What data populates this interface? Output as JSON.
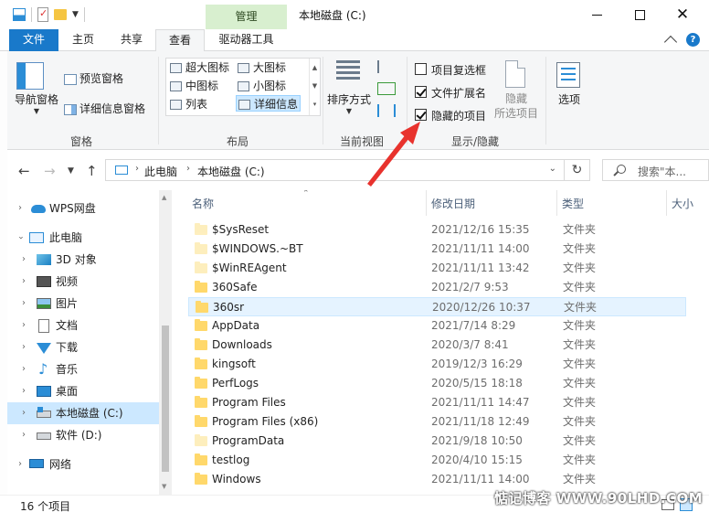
{
  "window": {
    "title": "本地磁盘 (C:)",
    "context_tab_group": "管理"
  },
  "tabs": [
    {
      "label": "文件"
    },
    {
      "label": "主页"
    },
    {
      "label": "共享"
    },
    {
      "label": "查看"
    },
    {
      "label": "驱动器工具"
    }
  ],
  "ribbon": {
    "panes": {
      "nav_pane": "导航窗格",
      "preview_pane": "预览窗格",
      "details_pane": "详细信息窗格",
      "group_label": "窗格"
    },
    "layout": {
      "items": [
        "超大图标",
        "大图标",
        "中图标",
        "小图标",
        "列表",
        "详细信息"
      ],
      "selected": "详细信息",
      "group_label": "布局"
    },
    "current_view": {
      "sort_by": "排序方式",
      "group_label": "当前视图"
    },
    "show_hide": {
      "item_checkboxes": {
        "label": "项目复选框",
        "checked": false
      },
      "file_extensions": {
        "label": "文件扩展名",
        "checked": true
      },
      "hidden_items": {
        "label": "隐藏的项目",
        "checked": true
      },
      "hide_selected": "隐藏",
      "hide_selected_2": "所选项目",
      "group_label": "显示/隐藏"
    },
    "options": "选项"
  },
  "address": {
    "crumbs": [
      "此电脑",
      "本地磁盘 (C:)"
    ],
    "search_placeholder": "搜索\"本..."
  },
  "nav_pane": {
    "items": [
      {
        "label": "WPS网盘",
        "icon": "cloud-icon"
      },
      {
        "label": "此电脑",
        "icon": "pc-icon"
      },
      {
        "label": "3D 对象",
        "icon": "3d-objects-icon"
      },
      {
        "label": "视频",
        "icon": "video-icon"
      },
      {
        "label": "图片",
        "icon": "pictures-icon"
      },
      {
        "label": "文档",
        "icon": "documents-icon"
      },
      {
        "label": "下载",
        "icon": "download-icon"
      },
      {
        "label": "音乐",
        "icon": "music-icon"
      },
      {
        "label": "桌面",
        "icon": "desktop-icon"
      },
      {
        "label": "本地磁盘 (C:)",
        "icon": "drive-c-icon",
        "selected": true
      },
      {
        "label": "软件 (D:)",
        "icon": "drive-d-icon"
      },
      {
        "label": "网络",
        "icon": "network-icon"
      }
    ]
  },
  "file_list": {
    "columns": [
      "名称",
      "修改日期",
      "类型",
      "大小"
    ],
    "rows": [
      {
        "name": "$SysReset",
        "date": "2021/12/16 15:35",
        "type": "文件夹",
        "hidden": true
      },
      {
        "name": "$WINDOWS.~BT",
        "date": "2021/11/11 14:00",
        "type": "文件夹",
        "hidden": true
      },
      {
        "name": "$WinREAgent",
        "date": "2021/11/11 13:42",
        "type": "文件夹",
        "hidden": true
      },
      {
        "name": "360Safe",
        "date": "2021/2/7 9:53",
        "type": "文件夹",
        "hidden": false
      },
      {
        "name": "360sr",
        "date": "2020/12/26 10:37",
        "type": "文件夹",
        "hidden": false
      },
      {
        "name": "AppData",
        "date": "2021/7/14 8:29",
        "type": "文件夹",
        "hidden": false
      },
      {
        "name": "Downloads",
        "date": "2020/3/7 8:41",
        "type": "文件夹",
        "hidden": false
      },
      {
        "name": "kingsoft",
        "date": "2019/12/3 16:29",
        "type": "文件夹",
        "hidden": false
      },
      {
        "name": "PerfLogs",
        "date": "2020/5/15 18:18",
        "type": "文件夹",
        "hidden": false
      },
      {
        "name": "Program Files",
        "date": "2021/11/11 14:47",
        "type": "文件夹",
        "hidden": false
      },
      {
        "name": "Program Files (x86)",
        "date": "2021/11/18 12:49",
        "type": "文件夹",
        "hidden": false
      },
      {
        "name": "ProgramData",
        "date": "2021/9/18 10:50",
        "type": "文件夹",
        "hidden": true
      },
      {
        "name": "testlog",
        "date": "2020/4/10 15:15",
        "type": "文件夹",
        "hidden": false
      },
      {
        "name": "Windows",
        "date": "2021/11/11 14:00",
        "type": "文件夹",
        "hidden": false
      }
    ]
  },
  "status": {
    "item_count": "16 个项目"
  },
  "watermark": "惦记博客 WWW.90LHD.COM",
  "colors": {
    "accent": "#1979ca",
    "selection": "#cce8ff",
    "folder": "#ffd86b",
    "annotation_arrow": "#e8322d",
    "context_tab": "#d8efcf"
  }
}
